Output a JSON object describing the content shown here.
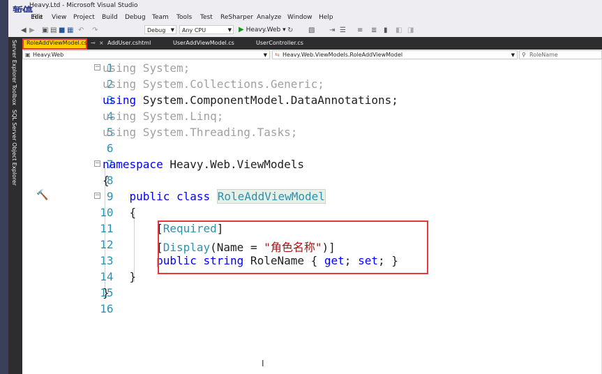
{
  "window": {
    "title": "Heavy.Ltd - Microsoft Visual Studio",
    "overlay": "暂停"
  },
  "menu": [
    "File",
    "Edit",
    "View",
    "Project",
    "Build",
    "Debug",
    "Team",
    "Tools",
    "Test",
    "ReSharper",
    "Analyze",
    "Window",
    "Help"
  ],
  "toolbar": {
    "config": "Debug",
    "platform": "Any CPU",
    "run_label": "Heavy.Web"
  },
  "side_tools": [
    "Server Explorer",
    "Toolbox",
    "SQL Server Object Explorer"
  ],
  "tabs": [
    {
      "label": "RoleAddViewModel.cs",
      "active": true
    },
    {
      "label": "AddUser.cshtml",
      "active": false
    },
    {
      "label": "UserAddViewModel.cs",
      "active": false
    },
    {
      "label": "UserController.cs",
      "active": false
    }
  ],
  "nav": {
    "project": "Heavy.Web",
    "class": "Heavy.Web.ViewModels.RoleAddViewModel",
    "member": "RoleName"
  },
  "code": {
    "l1_kw": "using",
    "l1_ns": " System;",
    "l2_kw": "using",
    "l2_ns": " System.Collections.Generic;",
    "l3_kw": "using",
    "l3_ns": " System.ComponentModel.DataAnnotations;",
    "l4_kw": "using",
    "l4_ns": " System.Linq;",
    "l5_kw": "using",
    "l5_ns": " System.Threading.Tasks;",
    "l7_kw": "namespace",
    "l7_ns": " Heavy.Web.ViewModels",
    "l8": "{",
    "l9_kw1": "public",
    "l9_kw2": "class",
    "l9_cls": "RoleAddViewModel",
    "l10": "{",
    "l11_b1": "[",
    "l11_attr": "Required",
    "l11_b2": "]",
    "l12_b1": "[",
    "l12_attr": "Display",
    "l12_p1": "(Name = ",
    "l12_str": "\"角色名称\"",
    "l12_p2": ")]",
    "l13_kw1": "public",
    "l13_kw2": "string",
    "l13_name": " RoleName { ",
    "l13_get": "get",
    "l13_sep": "; ",
    "l13_set": "set",
    "l13_end": "; }",
    "l14": "}",
    "l15": "}"
  },
  "line_numbers": [
    "1",
    "2",
    "3",
    "4",
    "5",
    "6",
    "7",
    "8",
    "9",
    "10",
    "11",
    "12",
    "13",
    "14",
    "15",
    "16"
  ]
}
